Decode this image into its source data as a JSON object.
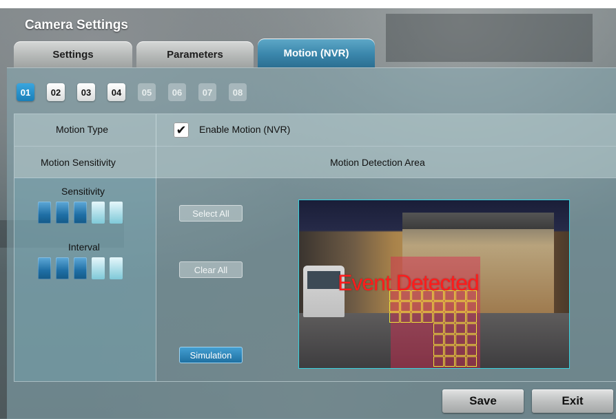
{
  "window": {
    "title": "Camera Settings"
  },
  "tabs": [
    {
      "label": "Settings",
      "active": false
    },
    {
      "label": "Parameters",
      "active": false
    },
    {
      "label": "Motion (NVR)",
      "active": true
    }
  ],
  "channels": [
    {
      "label": "01",
      "state": "active"
    },
    {
      "label": "02",
      "state": "enabled"
    },
    {
      "label": "03",
      "state": "enabled"
    },
    {
      "label": "04",
      "state": "enabled"
    },
    {
      "label": "05",
      "state": "disabled"
    },
    {
      "label": "06",
      "state": "disabled"
    },
    {
      "label": "07",
      "state": "disabled"
    },
    {
      "label": "08",
      "state": "disabled"
    }
  ],
  "motion_type": {
    "label": "Motion Type",
    "enable_label": "Enable Motion (NVR)",
    "enabled": true,
    "check_glyph": "✔"
  },
  "sensitivity_section": {
    "header": "Motion Sensitivity",
    "sensitivity_label": "Sensitivity",
    "sensitivity_level": 3,
    "sensitivity_max": 5,
    "interval_label": "Interval",
    "interval_level": 3,
    "interval_max": 5
  },
  "detection_area": {
    "header": "Motion Detection Area",
    "select_all": "Select All",
    "clear_all": "Clear All",
    "simulation": "Simulation",
    "overlay_text": "Event Detected"
  },
  "footer": {
    "save": "Save",
    "exit": "Exit"
  },
  "colors": {
    "accent": "#2c8cc3",
    "overlay_text": "#ff1b1b",
    "grid_cell": "#f2e43a",
    "video_border": "#39d3e0"
  }
}
